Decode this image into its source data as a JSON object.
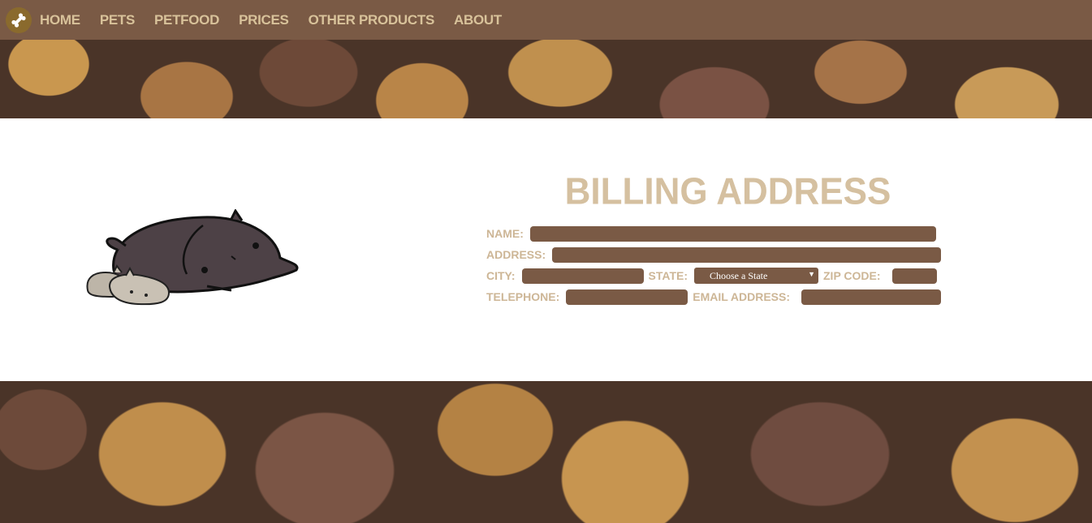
{
  "nav": {
    "items": [
      "HOME",
      "PETS",
      "PETFOOD",
      "PRICES",
      "OTHER PRODUCTS",
      "ABOUT"
    ]
  },
  "logo": {
    "icon": "bone-icon"
  },
  "mascot": {
    "icon": "sleeping-cats-illustration"
  },
  "form": {
    "title": "BILLING ADDRESS",
    "name_label": "NAME:",
    "address_label": "ADDRESS:",
    "city_label": "CITY:",
    "state_label": "STATE:",
    "state_value": "Choose a State",
    "zip_label": "ZIP CODE:",
    "telephone_label": "TELEPHONE:",
    "email_label": "EMAIL ADDRESS:",
    "name_value": "",
    "address_value": "",
    "city_value": "",
    "zip_value": "",
    "telephone_value": "",
    "email_value": ""
  },
  "colors": {
    "nav_bg": "#7a5a45",
    "nav_text": "#d8c29a",
    "title": "#d5c0a0",
    "field_bg": "#7a5a45"
  }
}
